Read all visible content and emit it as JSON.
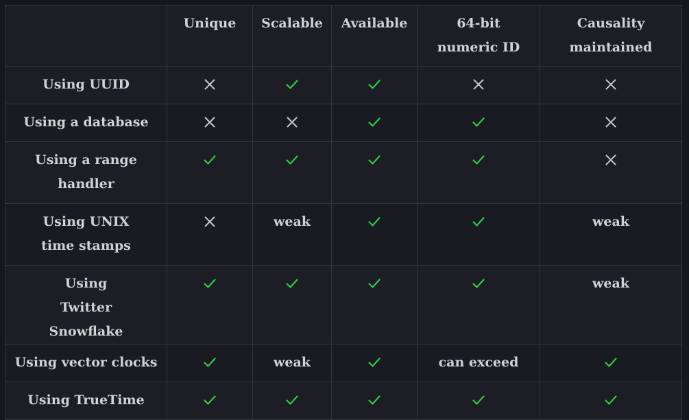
{
  "colors": {
    "check": "#2ecc40",
    "cross": "#c8c8ca"
  },
  "table": {
    "headers": [
      "",
      "Unique",
      "Scalable",
      "Available",
      "64-bit numeric ID",
      "Causality maintained"
    ],
    "rows": [
      {
        "label": "Using UUID",
        "cells": [
          "cross",
          "check",
          "check",
          "cross",
          "cross"
        ]
      },
      {
        "label": "Using a database",
        "cells": [
          "cross",
          "cross",
          "check",
          "check",
          "cross"
        ]
      },
      {
        "label": "Using a range handler",
        "cells": [
          "check",
          "check",
          "check",
          "check",
          "cross"
        ]
      },
      {
        "label": "Using UNIX time stamps",
        "cells": [
          "cross",
          "weak",
          "check",
          "check",
          "weak"
        ]
      },
      {
        "label": "Using Twitter Snowflake",
        "cells": [
          "check",
          "check",
          "check",
          "check",
          "weak"
        ]
      },
      {
        "label": "Using vector clocks",
        "cells": [
          "check",
          "weak",
          "check",
          "can exceed",
          "check"
        ]
      },
      {
        "label": "Using TrueTime",
        "cells": [
          "check",
          "check",
          "check",
          "check",
          "check"
        ]
      }
    ]
  }
}
